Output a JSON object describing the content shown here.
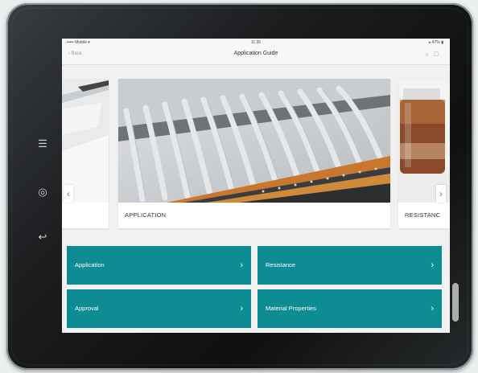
{
  "status_bar": {
    "carrier": "••••• Mobile ▾ ",
    "time": "11:35",
    "battery": "▸ 47% ▮"
  },
  "nav": {
    "back_label": "‹ Back",
    "title": "Application Guide"
  },
  "carousel": {
    "cards": [
      {
        "caption": ""
      },
      {
        "caption": "APPLICATION"
      },
      {
        "caption": "RESISTANC"
      }
    ],
    "prev_icon": "chevron-left-icon",
    "next_icon": "chevron-right-icon"
  },
  "tiles": [
    {
      "label": "Application"
    },
    {
      "label": "Resistance"
    },
    {
      "label": "Approval"
    },
    {
      "label": "Material Properties"
    }
  ],
  "colors": {
    "tile": "#0d8c93",
    "bezel": "#1b1d1f"
  }
}
